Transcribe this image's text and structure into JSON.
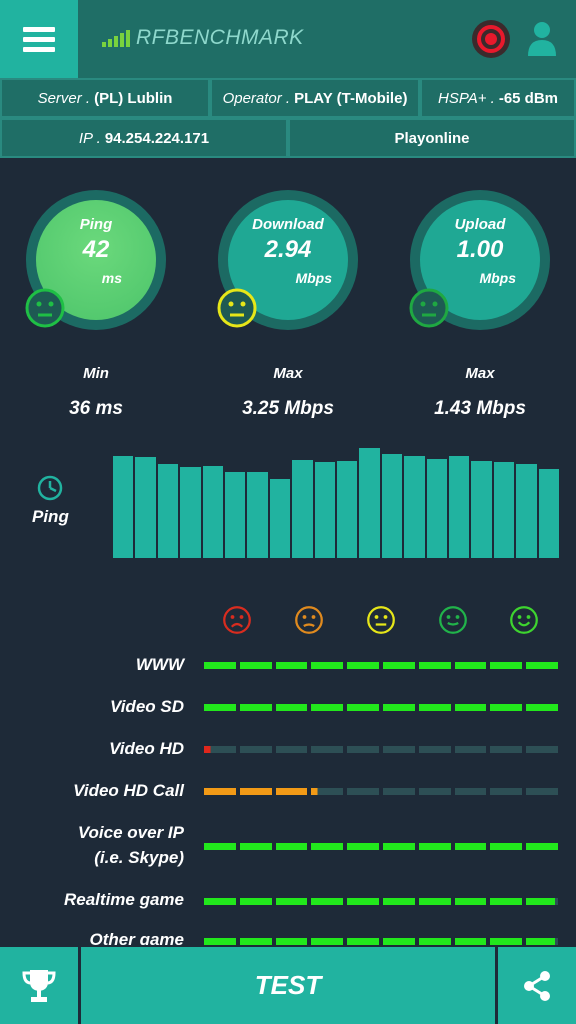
{
  "app": {
    "brand": "RFBENCHMARK"
  },
  "info": {
    "server_label": "Server .",
    "server_value": "(PL) Lublin",
    "operator_label": "Operator .",
    "operator_value": "PLAY (T-Mobile)",
    "network_label": "HSPA+ .",
    "network_value": "-65 dBm",
    "ip_label": "IP .",
    "ip_value": "94.254.224.171",
    "provider": "Playonline"
  },
  "gauges": [
    {
      "label": "Ping",
      "value": "42",
      "unit": "ms",
      "stat_label": "Min",
      "stat_value": "36 ms",
      "face": "green-neutral-face-icon",
      "color": "#5bd36b"
    },
    {
      "label": "Download",
      "value": "2.94",
      "unit": "Mbps",
      "stat_label": "Max",
      "stat_value": "3.25 Mbps",
      "face": "yellow-neutral-face-icon",
      "color": "#e6e619"
    },
    {
      "label": "Upload",
      "value": "1.00",
      "unit": "Mbps",
      "stat_label": "Max",
      "stat_value": "1.43 Mbps",
      "face": "green-neutral-face-icon",
      "color": "#21b34a"
    }
  ],
  "history": {
    "label": "Ping",
    "icon": "clock-icon",
    "chart_data": {
      "type": "bar",
      "values": [
        102,
        101,
        94,
        91,
        92,
        86,
        86,
        79,
        98,
        96,
        97,
        110,
        104,
        102,
        99,
        102,
        97,
        96,
        94,
        89
      ],
      "ylim": [
        0,
        118
      ]
    }
  },
  "quality": {
    "faces": [
      {
        "name": "very-bad-face-icon",
        "color": "#d92c1f"
      },
      {
        "name": "bad-face-icon",
        "color": "#e08a1e"
      },
      {
        "name": "neutral-face-icon",
        "color": "#e6e619"
      },
      {
        "name": "good-face-icon",
        "color": "#21b34a"
      },
      {
        "name": "very-good-face-icon",
        "color": "#3ed42f"
      }
    ],
    "rows": [
      {
        "label": "WWW",
        "level": 1.0,
        "color": "#22e81c"
      },
      {
        "label": "Video SD",
        "level": 1.0,
        "color": "#22e81c"
      },
      {
        "label": "Video HD",
        "level": 0.02,
        "color": "#e0271c"
      },
      {
        "label": "Video HD Call",
        "level": 0.32,
        "color": "#f29a16"
      },
      {
        "label": "Voice over IP",
        "label2": "(i.e. Skype)",
        "level": 1.0,
        "color": "#22e81c"
      },
      {
        "label": "Realtime game",
        "level": 0.99,
        "color": "#22e81c"
      },
      {
        "label": "Other game",
        "level": 0.99,
        "color": "#22e81c"
      }
    ]
  },
  "bottom": {
    "test_label": "TEST"
  },
  "colors": {
    "accent": "#21b3a0",
    "header": "#1f6e66",
    "background": "#1e2a38",
    "track": "#2d4f55"
  }
}
